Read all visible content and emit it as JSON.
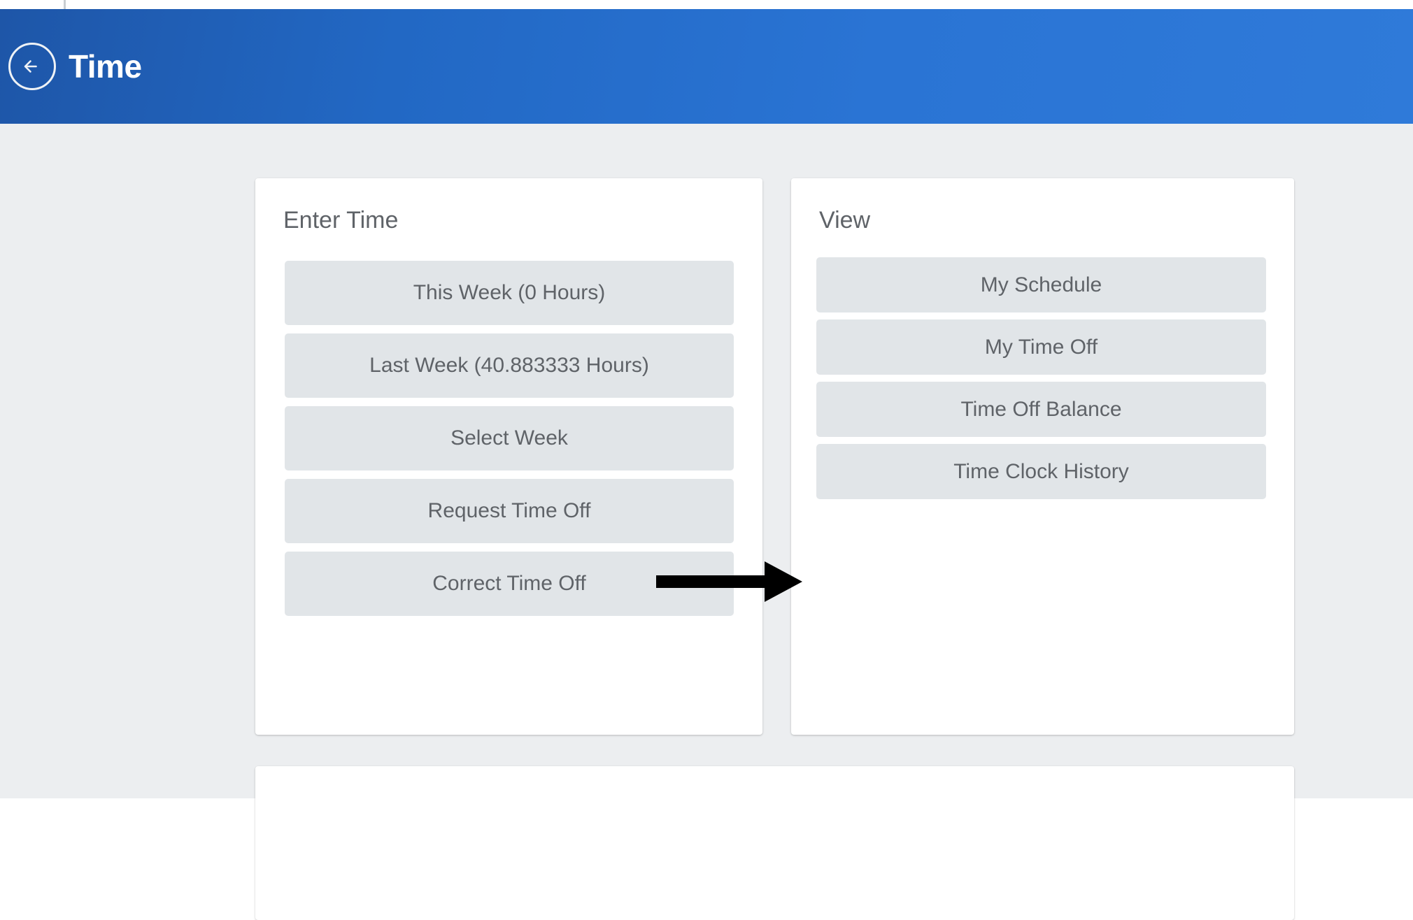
{
  "header": {
    "title": "Time",
    "back_icon": "arrow-left-icon",
    "background_color": "#2268c4",
    "text_color": "#ffffff"
  },
  "cards": {
    "enter_time": {
      "title": "Enter Time",
      "buttons": [
        {
          "label": "This Week (0 Hours)"
        },
        {
          "label": "Last Week (40.883333 Hours)"
        },
        {
          "label": "Select Week"
        },
        {
          "label": "Request Time Off"
        },
        {
          "label": "Correct Time Off"
        }
      ]
    },
    "view": {
      "title": "View",
      "buttons": [
        {
          "label": "My Schedule"
        },
        {
          "label": "My Time Off"
        },
        {
          "label": "Time Off Balance"
        },
        {
          "label": "Time Clock History"
        }
      ]
    }
  },
  "annotation": {
    "arrow_icon": "arrow-right-annotation",
    "color": "#000000"
  },
  "theme": {
    "page_background": "#eceef0",
    "card_background": "#ffffff",
    "button_background": "#e1e5e8",
    "button_text": "#5f6368"
  }
}
